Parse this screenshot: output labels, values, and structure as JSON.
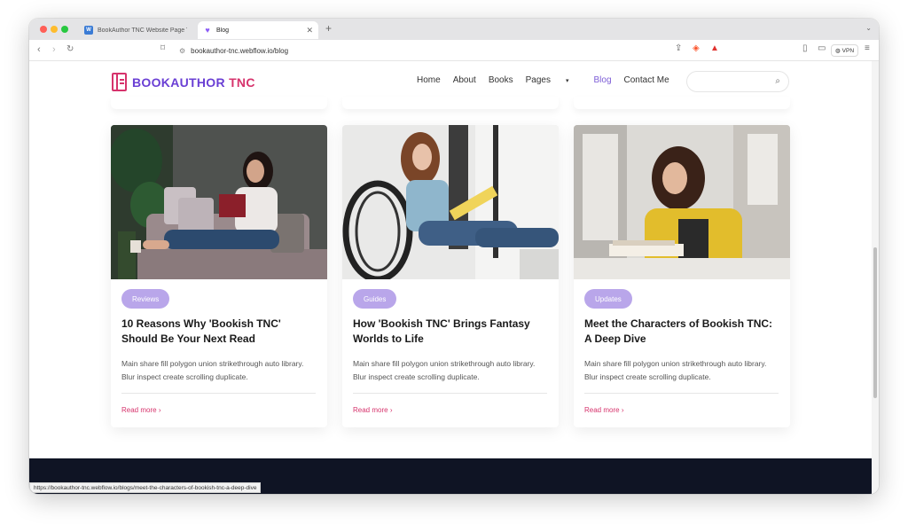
{
  "browser": {
    "tabs": [
      {
        "title": "BookAuthor TNC Website Page Tem",
        "active": false
      },
      {
        "title": "Blog",
        "active": true
      }
    ],
    "url": "bookauthor-tnc.webflow.io/blog",
    "vpn_label": "VPN",
    "status_url": "https://bookauthor-tnc.webflow.io/blogs/meet-the-characters-of-bookish-tnc-a-deep-dive"
  },
  "site": {
    "logo_part1": "BOOKAUTHOR",
    "logo_part2": " TNC",
    "nav": {
      "home": "Home",
      "about": "About",
      "books": "Books",
      "pages": "Pages",
      "blog": "Blog",
      "contact": "Contact Me"
    },
    "search_placeholder": ""
  },
  "cards": [
    {
      "tag": "Reviews",
      "title": "10 Reasons Why 'Bookish TNC' Should Be Your Next Read",
      "desc": "Main share fill polygon union strikethrough auto library. Blur inspect create scrolling duplicate.",
      "link": "Read more"
    },
    {
      "tag": "Guides",
      "title": "How 'Bookish TNC' Brings Fantasy Worlds to Life",
      "desc": "Main share fill polygon union strikethrough auto library. Blur inspect create scrolling duplicate.",
      "link": "Read more"
    },
    {
      "tag": "Updates",
      "title": "Meet the Characters of Bookish TNC: A Deep Dive",
      "desc": "Main share fill polygon union strikethrough auto library. Blur inspect create scrolling duplicate.",
      "link": "Read more"
    }
  ],
  "colors": {
    "brand_purple": "#6a3fd4",
    "brand_pink": "#d6336c",
    "tag_bg": "#b9a6ea",
    "footer": "#0f1424"
  }
}
